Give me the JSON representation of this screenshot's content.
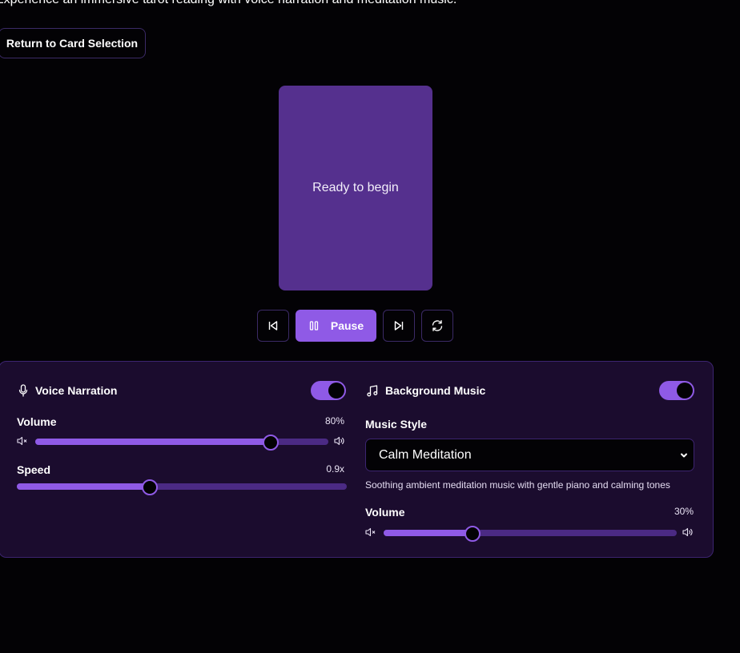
{
  "intro_text": "Experience an immersive tarot reading with voice narration and meditation music.",
  "return_button": "Return to Card Selection",
  "card": {
    "status": "Ready to begin"
  },
  "controls": {
    "pause_label": "Pause"
  },
  "voice": {
    "title": "Voice Narration",
    "enabled": true,
    "volume_label": "Volume",
    "volume_value": "80%",
    "volume_level": 0.8,
    "speed_label": "Speed",
    "speed_value": "0.9x",
    "speed_level": 0.4
  },
  "music": {
    "title": "Background Music",
    "enabled": true,
    "style_label": "Music Style",
    "style_selected": "Calm Meditation",
    "description": "Soothing ambient meditation music with gentle piano and calming tones",
    "volume_label": "Volume",
    "volume_value": "30%",
    "volume_level": 0.3
  },
  "colors": {
    "accent": "#8f5ae6",
    "card": "#55308e",
    "panel": "#1b0c2e",
    "background": "#030205"
  },
  "icons": [
    "skip-back-icon",
    "pause-icon",
    "skip-forward-icon",
    "restart-icon",
    "microphone-icon",
    "music-note-icon",
    "volume-mute-icon",
    "volume-up-icon",
    "chevron-down-icon"
  ]
}
